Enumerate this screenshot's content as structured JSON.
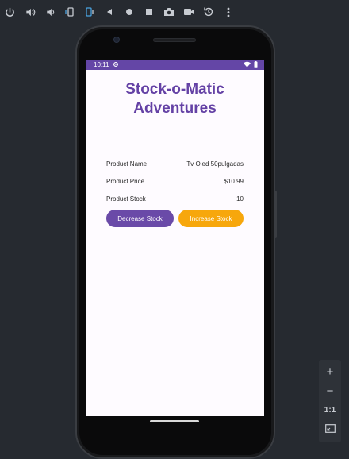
{
  "toolbar": {
    "items": [
      {
        "name": "power-icon"
      },
      {
        "name": "volume-up-icon"
      },
      {
        "name": "volume-down-icon"
      },
      {
        "name": "rotate-left-icon"
      },
      {
        "name": "rotate-right-icon"
      },
      {
        "name": "back-icon"
      },
      {
        "name": "home-icon"
      },
      {
        "name": "overview-icon"
      },
      {
        "name": "screenshot-icon"
      },
      {
        "name": "screen-record-icon"
      },
      {
        "name": "snapshot-icon"
      },
      {
        "name": "more-icon"
      }
    ]
  },
  "statusbar": {
    "time": "10:11",
    "bg_color": "#6446a6"
  },
  "app": {
    "title_line1": "Stock-o-Matic",
    "title_line2": "Adventures",
    "title_color": "#6441a5",
    "rows": [
      {
        "label": "Product Name",
        "value": "Tv Oled 50pulgadas"
      },
      {
        "label": "Product Price",
        "value": "$10.99"
      },
      {
        "label": "Product Stock",
        "value": "10"
      }
    ],
    "decrease_label": "Decrease Stock",
    "increase_label": "Increase Stock",
    "decrease_color": "#6a4aa8",
    "increase_color": "#f7a70c"
  },
  "zoom": {
    "zoom_in": "+",
    "zoom_out": "−",
    "actual_size": "1:1"
  }
}
